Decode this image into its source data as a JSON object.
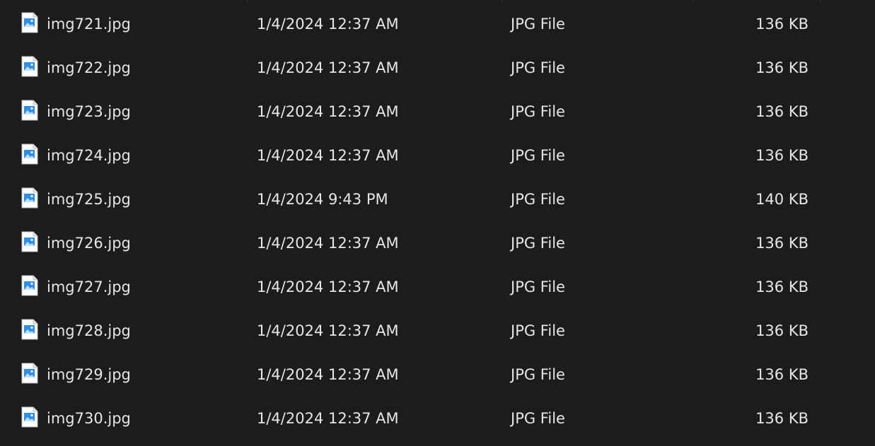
{
  "files": [
    {
      "name": "img721.jpg",
      "date": "1/4/2024 12:37 AM",
      "type": "JPG File",
      "size": "136 KB",
      "icon": "image-file-icon"
    },
    {
      "name": "img722.jpg",
      "date": "1/4/2024 12:37 AM",
      "type": "JPG File",
      "size": "136 KB",
      "icon": "image-file-icon"
    },
    {
      "name": "img723.jpg",
      "date": "1/4/2024 12:37 AM",
      "type": "JPG File",
      "size": "136 KB",
      "icon": "image-file-icon"
    },
    {
      "name": "img724.jpg",
      "date": "1/4/2024 12:37 AM",
      "type": "JPG File",
      "size": "136 KB",
      "icon": "image-file-icon"
    },
    {
      "name": "img725.jpg",
      "date": "1/4/2024 9:43 PM",
      "type": "JPG File",
      "size": "140 KB",
      "icon": "image-file-icon"
    },
    {
      "name": "img726.jpg",
      "date": "1/4/2024 12:37 AM",
      "type": "JPG File",
      "size": "136 KB",
      "icon": "image-file-icon"
    },
    {
      "name": "img727.jpg",
      "date": "1/4/2024 12:37 AM",
      "type": "JPG File",
      "size": "136 KB",
      "icon": "image-file-icon"
    },
    {
      "name": "img728.jpg",
      "date": "1/4/2024 12:37 AM",
      "type": "JPG File",
      "size": "136 KB",
      "icon": "image-file-icon"
    },
    {
      "name": "img729.jpg",
      "date": "1/4/2024 12:37 AM",
      "type": "JPG File",
      "size": "136 KB",
      "icon": "image-file-icon"
    },
    {
      "name": "img730.jpg",
      "date": "1/4/2024 12:37 AM",
      "type": "JPG File",
      "size": "136 KB",
      "icon": "image-file-icon"
    }
  ],
  "colors": {
    "background": "#1c1c1c",
    "text": "#e6e6e6",
    "icon_accent": "#2f8fe8"
  }
}
